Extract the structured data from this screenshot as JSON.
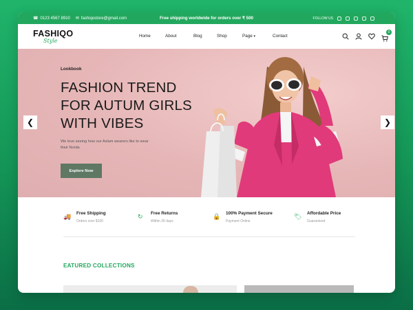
{
  "topbar": {
    "phone": "0123 4567 8910",
    "email": "fashiqostore@gmail.com",
    "announcement": "Free shipping worldwide for orders over ₹ 500",
    "follow_label": "FOLLOW US"
  },
  "logo": {
    "brand": "FASHIQO",
    "tagline": "Style"
  },
  "nav": {
    "items": [
      "Home",
      "About",
      "Blog",
      "Shop",
      "Page",
      "Contact"
    ]
  },
  "header_icons": {
    "cart_count": "0"
  },
  "hero": {
    "eyebrow": "Lookbook",
    "title_lines": [
      "FASHION TREND",
      "FOR AUTUM GIRLS",
      "WITH VIBES"
    ],
    "description": "We love seeing how our Aslam wearers like to wear their Norda",
    "cta": "Explore Now"
  },
  "features": [
    {
      "title": "Free Shipping",
      "subtitle": "Orders over $100",
      "icon": "truck-icon"
    },
    {
      "title": "Free Returns",
      "subtitle": "Within 30 days",
      "icon": "refresh-icon"
    },
    {
      "title": "100% Payment Secure",
      "subtitle": "Payment Online",
      "icon": "lock-icon"
    },
    {
      "title": "Affordable Price",
      "subtitle": "Guaranteed",
      "icon": "tag-icon"
    }
  ],
  "collections": {
    "title": "EATURED COLLECTIONS"
  },
  "colors": {
    "brand_green": "#22a85e",
    "hero_bg": "#e9bfc0",
    "button": "#5e7864",
    "jacket": "#e03a7a"
  }
}
